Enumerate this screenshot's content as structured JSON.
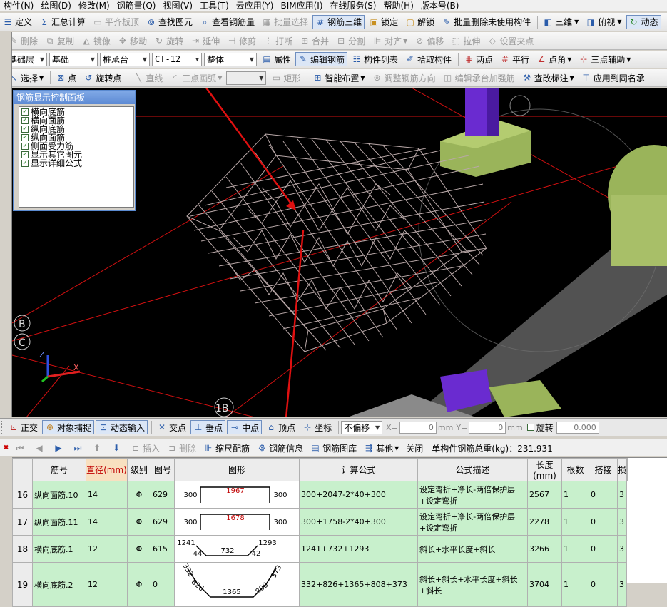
{
  "menu": [
    "构件(N)",
    "绘图(D)",
    "修改(M)",
    "钢筋量(Q)",
    "视图(V)",
    "工具(T)",
    "云应用(Y)",
    "BIM应用(I)",
    "在线服务(S)",
    "帮助(H)",
    "版本号(B)"
  ],
  "toolbar1": {
    "define": "定义",
    "summary": "汇总计算",
    "flat_slab": "平齐板顶",
    "find": "查找图元",
    "view_rebar": "查看钢筋量",
    "batch_select": "批量选择",
    "rebar_3d": "钢筋三维",
    "lock": "锁定",
    "unlock": "解锁",
    "batch_delete": "批量删除未使用构件",
    "three_d": "三维",
    "top_view": "俯视",
    "dynamic": "动态"
  },
  "toolbar2": {
    "delete": "删除",
    "copy": "复制",
    "mirror": "镜像",
    "move": "移动",
    "rotate": "旋转",
    "extend": "延伸",
    "trim": "修剪",
    "break": "打断",
    "merge": "合并",
    "split": "分割",
    "align": "对齐",
    "offset": "偏移",
    "stretch": "拉伸",
    "set_pinch": "设置夹点"
  },
  "toolbar3": {
    "layer": "基础层",
    "category": "基础",
    "type": "桩承台",
    "component": "CT-12",
    "whole": "整体",
    "property": "属性",
    "edit_rebar": "编辑钢筋",
    "component_list": "构件列表",
    "pick": "拾取构件",
    "two_points": "两点",
    "parallel": "平行",
    "point_angle": "点角",
    "three_point_aux": "三点辅助"
  },
  "toolbar4": {
    "select": "选择",
    "point": "点",
    "rotate_point": "旋转点",
    "line": "直线",
    "three_point_arc": "三点画弧",
    "rect": "矩形",
    "smart_layout": "智能布置",
    "adjust_dir": "调整钢筋方向",
    "edit_cap": "编辑承台加强筋",
    "modify_label": "查改标注",
    "apply_same": "应用到同名承"
  },
  "control_panel": {
    "title": "钢筋显示控制面板",
    "items": [
      "横向底筋",
      "横向面筋",
      "纵向底筋",
      "纵向面筋",
      "侧面受力筋",
      "显示其它图元",
      "显示详细公式"
    ]
  },
  "viewport": {
    "axis_b": "B",
    "axis_c": "C",
    "axis_1b": "1B",
    "axis_x": "X",
    "axis_z": "Z"
  },
  "snapbar": {
    "ortho": "正交",
    "snap": "对象捕捉",
    "dynamic_input": "动态输入",
    "intersect": "交点",
    "perpendicular": "垂点",
    "midpoint": "中点",
    "vertex": "顶点",
    "coord": "坐标",
    "offset_mode": "不偏移",
    "x_label": "X=",
    "x_val": "0",
    "y_label": "Y=",
    "y_val": "0",
    "unit": "mm",
    "rotate": "旋转",
    "rotate_val": "0.000"
  },
  "gridtb": {
    "insert": "插入",
    "delete": "删除",
    "scale_rebar": "缩尺配筋",
    "rebar_info": "钢筋信息",
    "rebar_lib": "钢筋图库",
    "other": "其他",
    "close": "关闭",
    "total_weight": "单构件钢筋总重(kg)：231.931"
  },
  "columns": [
    "筋号",
    "直径(mm)",
    "级别",
    "图号",
    "图形",
    "计算公式",
    "公式描述",
    "长度(mm)",
    "根数",
    "搭接",
    "损"
  ],
  "rows": [
    {
      "num": "16",
      "name": "纵向面筋.10",
      "dia": "14",
      "grade": "Φ",
      "fig": "629",
      "shape": {
        "l": "300",
        "m": "1967",
        "r": "300"
      },
      "formula": "300+2047-2*40+300",
      "desc": "设定弯折+净长-两倍保护层+设定弯折",
      "len": "2567",
      "cnt": "1",
      "lap": "0",
      "loss": "3"
    },
    {
      "num": "17",
      "name": "纵向面筋.11",
      "dia": "14",
      "grade": "Φ",
      "fig": "629",
      "shape": {
        "l": "300",
        "m": "1678",
        "r": "300"
      },
      "formula": "300+1758-2*40+300",
      "desc": "设定弯折+净长-两倍保护层+设定弯折",
      "len": "2278",
      "cnt": "1",
      "lap": "0",
      "loss": "3"
    },
    {
      "num": "18",
      "name": "横向底筋.1",
      "dia": "12",
      "grade": "Φ",
      "fig": "615",
      "shape": {
        "l": "1241",
        "m": "732",
        "r": "1293",
        "a": "44",
        "b": "42"
      },
      "formula": "1241+732+1293",
      "desc": "斜长+水平长度+斜长",
      "len": "3266",
      "cnt": "1",
      "lap": "0",
      "loss": "3"
    },
    {
      "num": "19",
      "name": "横向底筋.2",
      "dia": "12",
      "grade": "Φ",
      "fig": "0",
      "shape": {
        "a": "332",
        "b": "826",
        "c": "1365",
        "d": "808",
        "e": "373"
      },
      "formula": "332+826+1365+808+373",
      "desc": "斜长+斜长+水平长度+斜长+斜长",
      "len": "3704",
      "cnt": "1",
      "lap": "0",
      "loss": "3"
    }
  ]
}
